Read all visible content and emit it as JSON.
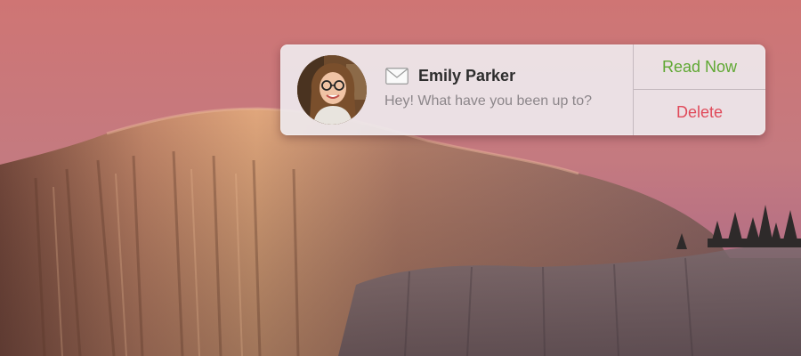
{
  "notification": {
    "sender": "Emily Parker",
    "message": "Hey! What have you been up to?",
    "app_icon": "mail-icon",
    "avatar": "sender-avatar",
    "actions": {
      "read_now": "Read Now",
      "delete": "Delete"
    }
  },
  "colors": {
    "read_now": "#5fa833",
    "delete": "#e04a5a",
    "panel": "#eee8ec"
  }
}
